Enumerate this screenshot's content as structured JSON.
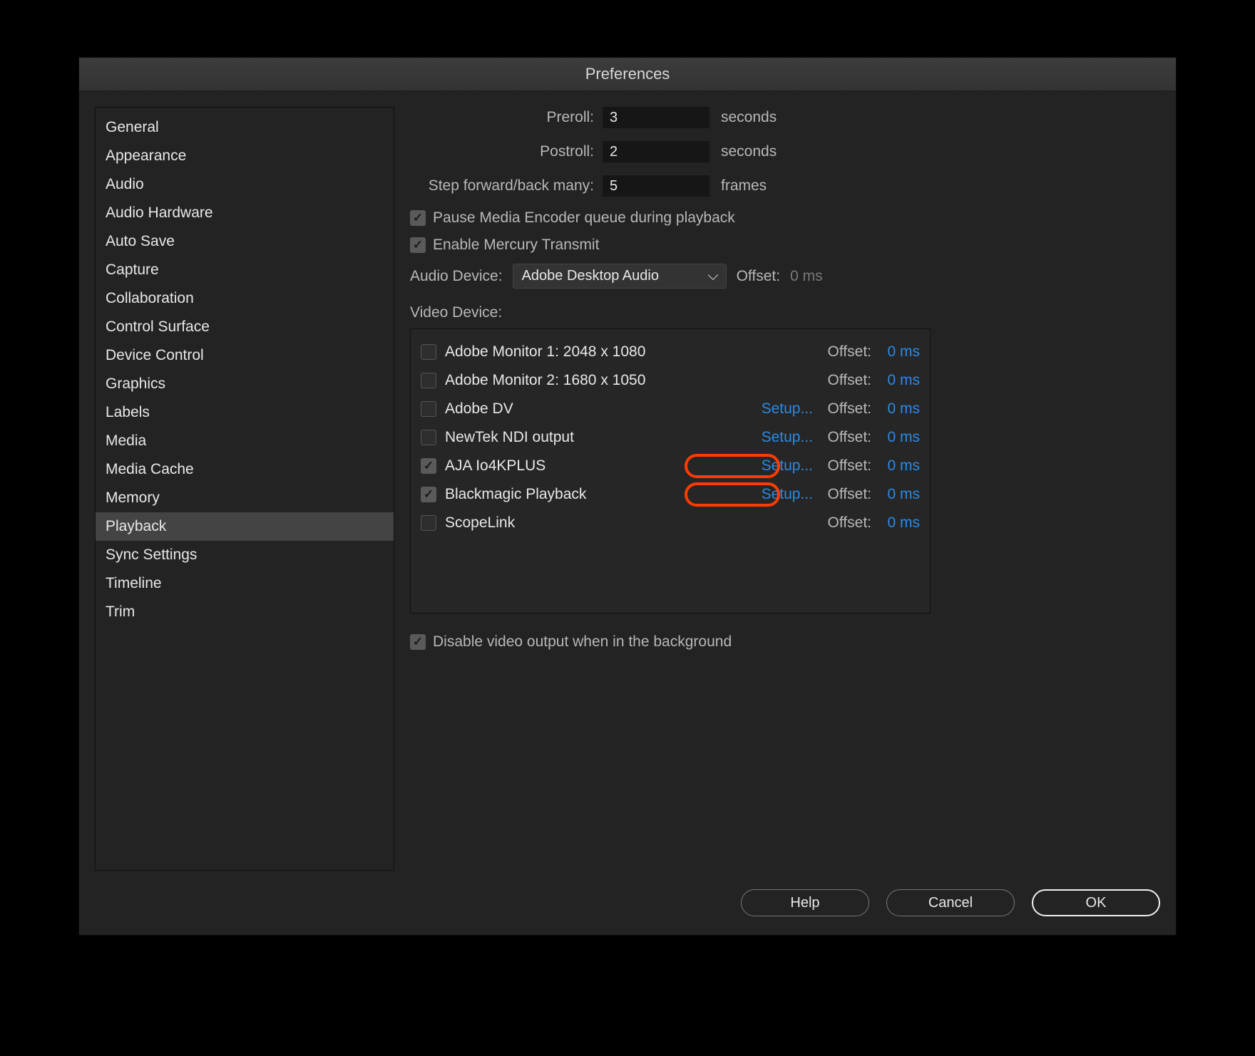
{
  "title": "Preferences",
  "sidebar": {
    "items": [
      "General",
      "Appearance",
      "Audio",
      "Audio Hardware",
      "Auto Save",
      "Capture",
      "Collaboration",
      "Control Surface",
      "Device Control",
      "Graphics",
      "Labels",
      "Media",
      "Media Cache",
      "Memory",
      "Playback",
      "Sync Settings",
      "Timeline",
      "Trim"
    ],
    "selected": "Playback"
  },
  "form": {
    "preroll": {
      "label": "Preroll:",
      "value": "3",
      "suffix": "seconds"
    },
    "postroll": {
      "label": "Postroll:",
      "value": "2",
      "suffix": "seconds"
    },
    "step": {
      "label": "Step forward/back many:",
      "value": "5",
      "suffix": "frames"
    }
  },
  "checks": {
    "pause": {
      "label": "Pause Media Encoder queue during playback",
      "checked": true
    },
    "mercury": {
      "label": "Enable Mercury Transmit",
      "checked": true
    },
    "disableBg": {
      "label": "Disable video output when in the background",
      "checked": true
    }
  },
  "audio": {
    "label": "Audio Device:",
    "value": "Adobe Desktop Audio",
    "offsetLabel": "Offset:",
    "offsetValue": "0 ms"
  },
  "video": {
    "label": "Video Device:",
    "setupText": "Setup...",
    "offsetLabel": "Offset:",
    "devices": [
      {
        "name": "Adobe Monitor 1: 2048 x 1080",
        "checked": false,
        "setup": false,
        "offset": "0 ms",
        "highlight": false
      },
      {
        "name": "Adobe Monitor 2: 1680 x 1050",
        "checked": false,
        "setup": false,
        "offset": "0 ms",
        "highlight": false
      },
      {
        "name": "Adobe DV",
        "checked": false,
        "setup": true,
        "offset": "0 ms",
        "highlight": false
      },
      {
        "name": "NewTek NDI output",
        "checked": false,
        "setup": true,
        "offset": "0 ms",
        "highlight": false
      },
      {
        "name": "AJA Io4KPLUS",
        "checked": true,
        "setup": true,
        "offset": "0 ms",
        "highlight": true
      },
      {
        "name": "Blackmagic Playback",
        "checked": true,
        "setup": true,
        "offset": "0 ms",
        "highlight": true
      },
      {
        "name": "ScopeLink",
        "checked": false,
        "setup": false,
        "offset": "0 ms",
        "highlight": false
      }
    ]
  },
  "buttons": {
    "help": "Help",
    "cancel": "Cancel",
    "ok": "OK"
  }
}
